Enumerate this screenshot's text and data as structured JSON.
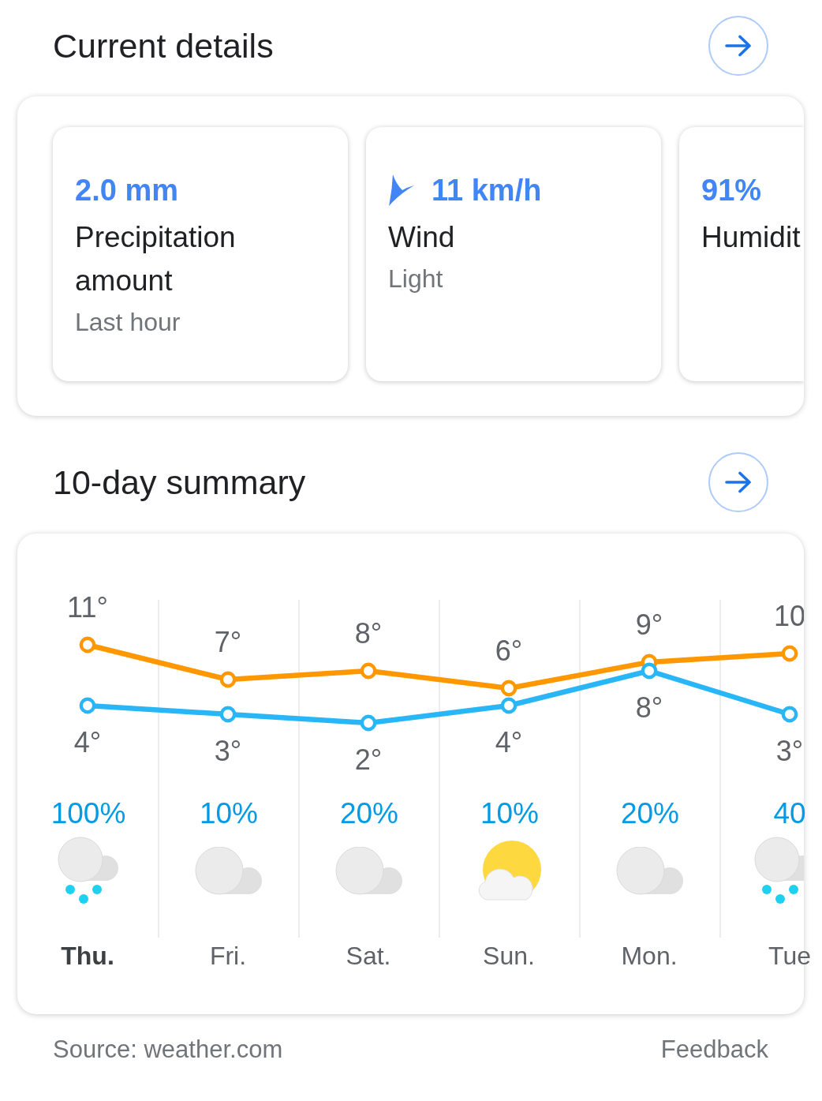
{
  "current_details": {
    "title": "Current details",
    "tiles": [
      {
        "kind": "value",
        "value": "2.0 mm",
        "title": "Precipitation amount",
        "subtitle": "Last hour"
      },
      {
        "kind": "direction",
        "value": "11 km/h",
        "title": "Wind",
        "subtitle": "Light"
      },
      {
        "kind": "value",
        "value": "91%",
        "title": "Humidit"
      }
    ]
  },
  "summary": {
    "title": "10-day summary",
    "chart_data": {
      "type": "line",
      "categories": [
        "Thu.",
        "Fri.",
        "Sat.",
        "Sun.",
        "Mon.",
        "Tue"
      ],
      "series": [
        {
          "color": "#ff9800",
          "marker": "circle",
          "values": [
            11,
            7,
            8,
            6,
            9,
            10
          ],
          "value_labels": [
            "11°",
            "7°",
            "8°",
            "6°",
            "9°",
            "10"
          ]
        },
        {
          "color": "#29b6f6",
          "marker": "circle",
          "values": [
            4,
            3,
            2,
            4,
            8,
            3
          ],
          "value_labels": [
            "4°",
            "3°",
            "2°",
            "4°",
            "8°",
            "3°"
          ]
        }
      ]
    },
    "days": [
      {
        "precipitation": "100%",
        "kind": "rain",
        "selected": true
      },
      {
        "precipitation": "10%",
        "kind": "cloud",
        "selected": false
      },
      {
        "precipitation": "20%",
        "kind": "cloud",
        "selected": false
      },
      {
        "precipitation": "10%",
        "kind": "sun_cloud",
        "selected": false
      },
      {
        "precipitation": "20%",
        "kind": "cloud",
        "selected": false
      },
      {
        "precipitation": "40",
        "kind": "rain",
        "selected": false
      }
    ]
  },
  "footer": {
    "source": "Source: weather.com",
    "feedback": "Feedback"
  }
}
